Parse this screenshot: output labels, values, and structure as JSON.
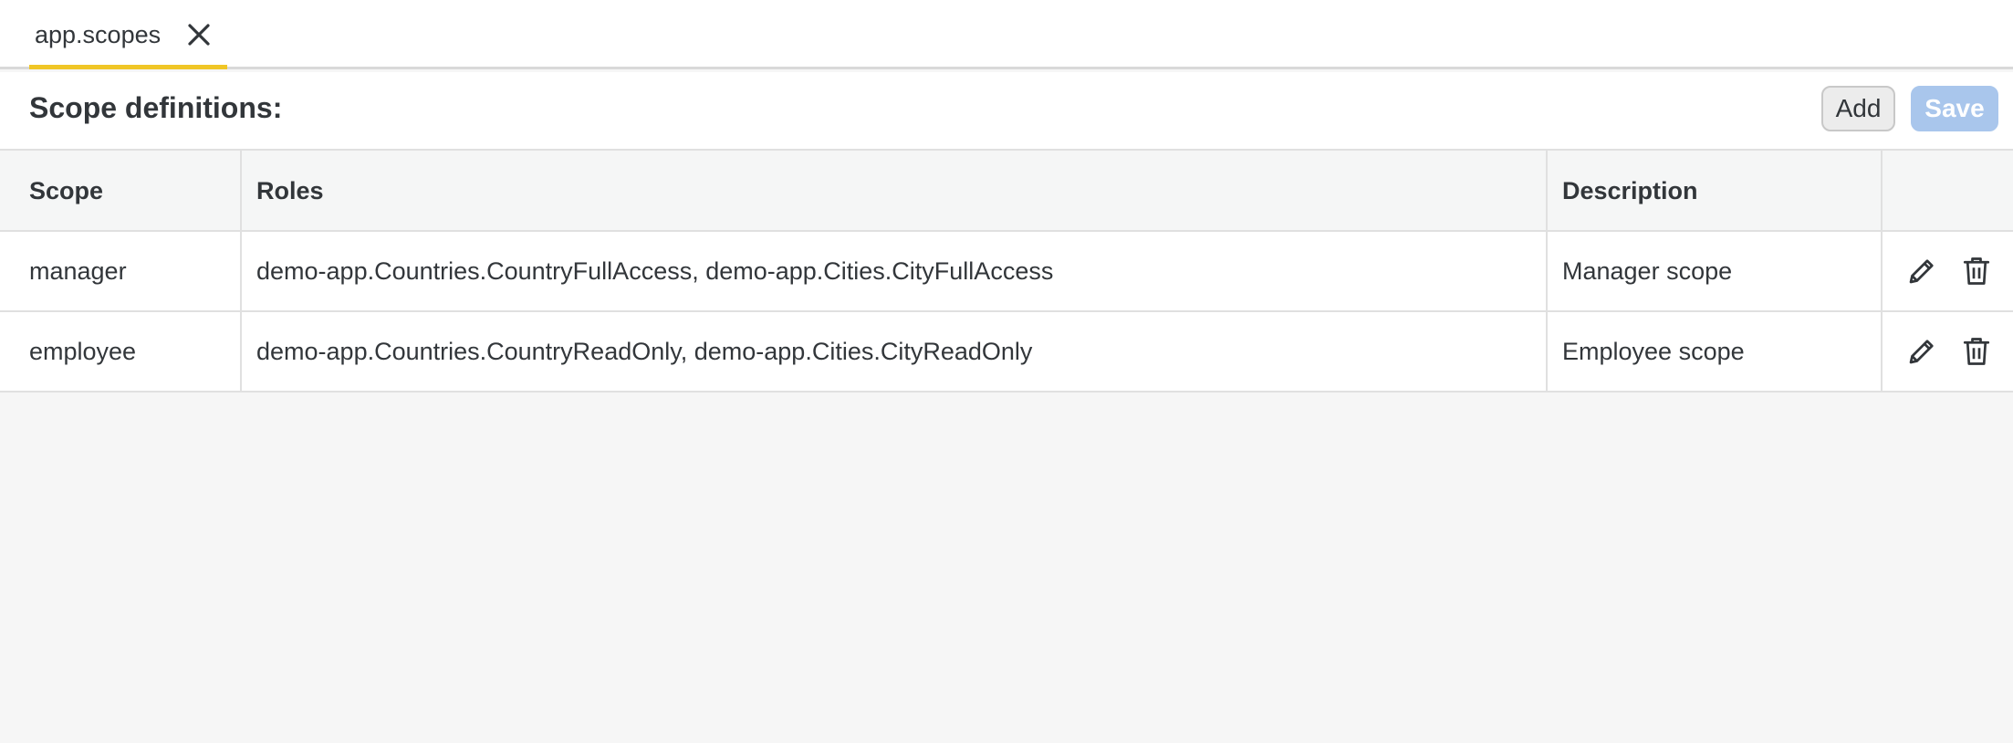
{
  "tab": {
    "label": "app.scopes",
    "close_icon": "close-icon",
    "accent_color": "#f0c626"
  },
  "toolbar": {
    "title": "Scope definitions:",
    "add_label": "Add",
    "save_label": "Save",
    "save_disabled": true
  },
  "table": {
    "columns": [
      "Scope",
      "Roles",
      "Description",
      ""
    ],
    "rows": [
      {
        "scope": "manager",
        "roles": "demo-app.Countries.CountryFullAccess, demo-app.Cities.CityFullAccess",
        "description": "Manager scope",
        "actions": [
          "edit-icon",
          "delete-icon"
        ]
      },
      {
        "scope": "employee",
        "roles": "demo-app.Countries.CountryReadOnly, demo-app.Cities.CityReadOnly",
        "description": "Employee scope",
        "actions": [
          "edit-icon",
          "delete-icon"
        ]
      }
    ]
  }
}
